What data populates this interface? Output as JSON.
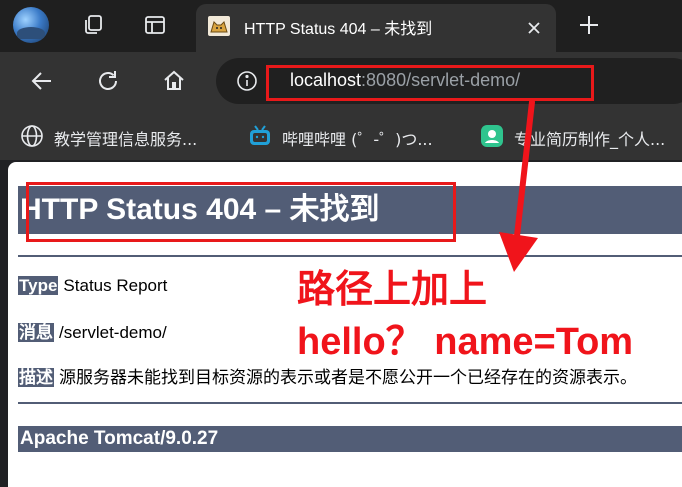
{
  "browser": {
    "tab": {
      "title": "HTTP Status 404 – 未找到"
    },
    "address": {
      "host": "localhost",
      "rest": ":8080/servlet-demo/"
    },
    "bookmarks": [
      {
        "label": "教学管理信息服务...",
        "icon": "globe-icon"
      },
      {
        "label": "哔哩哔哩 (゜-゜)つ...",
        "icon": "bilibili-icon"
      },
      {
        "label": "专业简历制作_个人...",
        "icon": "resume-site-icon"
      }
    ],
    "colors": {
      "chrome_dark": "#1f1f1f",
      "toolbar": "#333333",
      "tomcat_bar": "#525d76",
      "annotation_red": "#f0141b"
    }
  },
  "page": {
    "heading": "HTTP Status 404 – 未找到",
    "type_label": "Type",
    "type_value": "Status Report",
    "message_label": "消息",
    "message_value": "/servlet-demo/",
    "description_label": "描述",
    "description_value": "源服务器未能找到目标资源的表示或者是不愿公开一个已经存在的资源表示。",
    "footer": "Apache Tomcat/9.0.27"
  },
  "annotation": {
    "line1": "路径上加上",
    "line2": "hello？ name=Tom"
  }
}
